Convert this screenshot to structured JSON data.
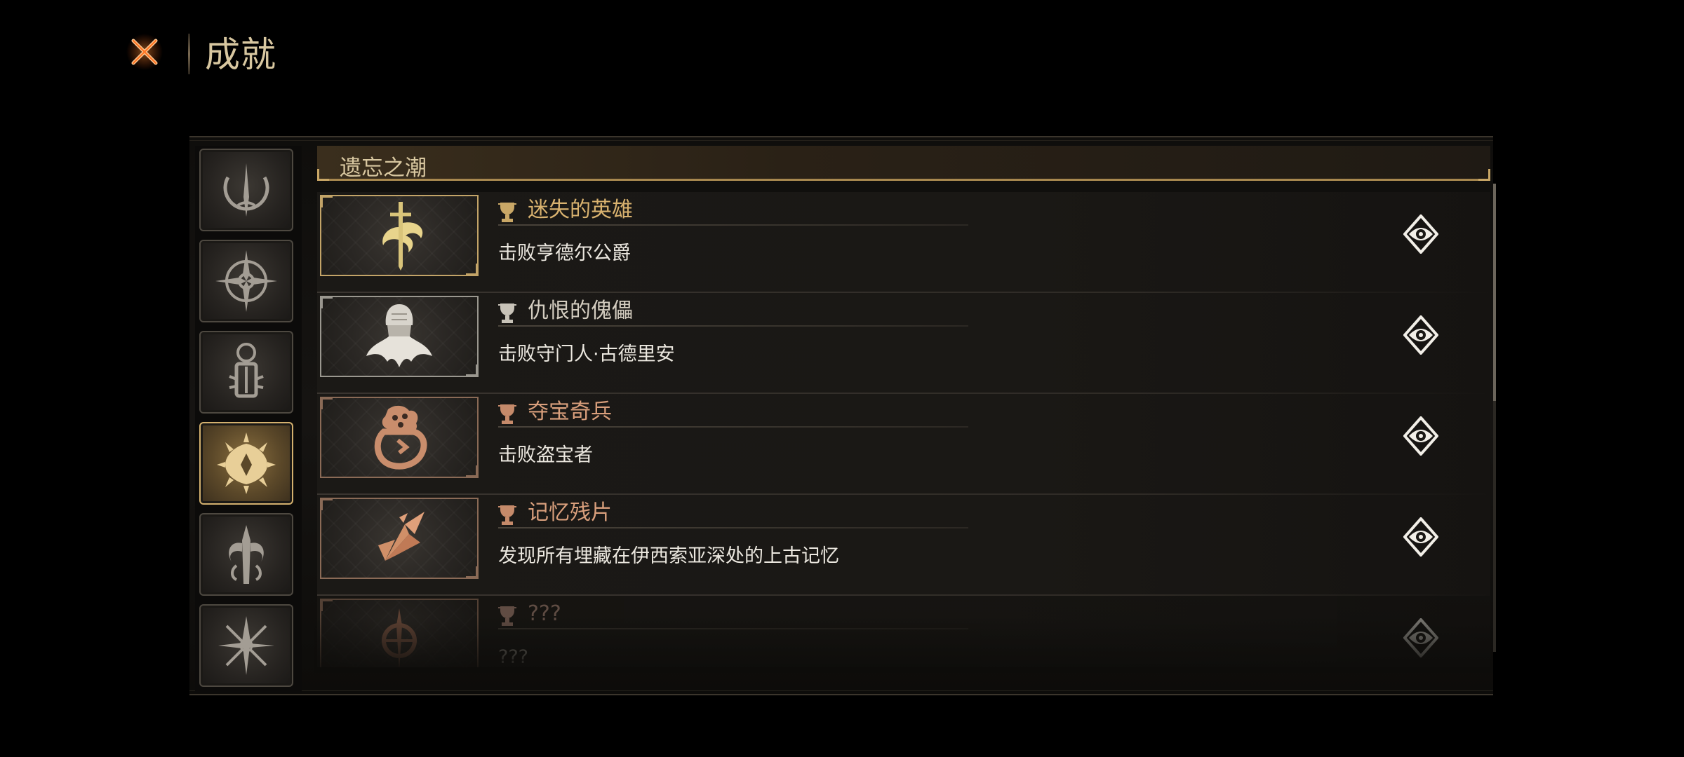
{
  "header": {
    "title": "成就",
    "close_icon": "close-x-icon"
  },
  "sidebar": {
    "items": [
      {
        "icon": "crescent-spire-emblem-icon",
        "active": false
      },
      {
        "icon": "compass-star-emblem-icon",
        "active": false
      },
      {
        "icon": "lantern-totem-emblem-icon",
        "active": false
      },
      {
        "icon": "radiant-eye-emblem-icon",
        "active": true
      },
      {
        "icon": "tentacle-sword-emblem-icon",
        "active": false
      },
      {
        "icon": "thorn-cross-emblem-icon",
        "active": false
      }
    ]
  },
  "section": {
    "title": "遗忘之潮"
  },
  "achievements": [
    {
      "title": "迷失的英雄",
      "desc": "击败亨德尔公爵",
      "tier": "gold",
      "title_color": "#d9b26f",
      "icon": "winged-sword-icon"
    },
    {
      "title": "仇恨的傀儡",
      "desc": "击败守门人·古德里安",
      "tier": "silver",
      "title_color": "#d4cdc0",
      "icon": "hooded-golem-icon"
    },
    {
      "title": "夺宝奇兵",
      "desc": "击败盗宝者",
      "tier": "bronze",
      "title_color": "#d99f7c",
      "icon": "treasure-pouch-icon"
    },
    {
      "title": "记忆残片",
      "desc": "发现所有埋藏在伊西索亚深处的上古记忆",
      "tier": "bronze",
      "title_color": "#d99f7c",
      "icon": "shard-fragment-icon"
    },
    {
      "title": "???",
      "desc": "???",
      "tier": "bronze",
      "title_color": "#a08070",
      "icon": "locked-sigil-icon"
    }
  ],
  "colors": {
    "gold": "#c3a468",
    "accent_orange": "#ff7a2a",
    "background": "#000000"
  }
}
